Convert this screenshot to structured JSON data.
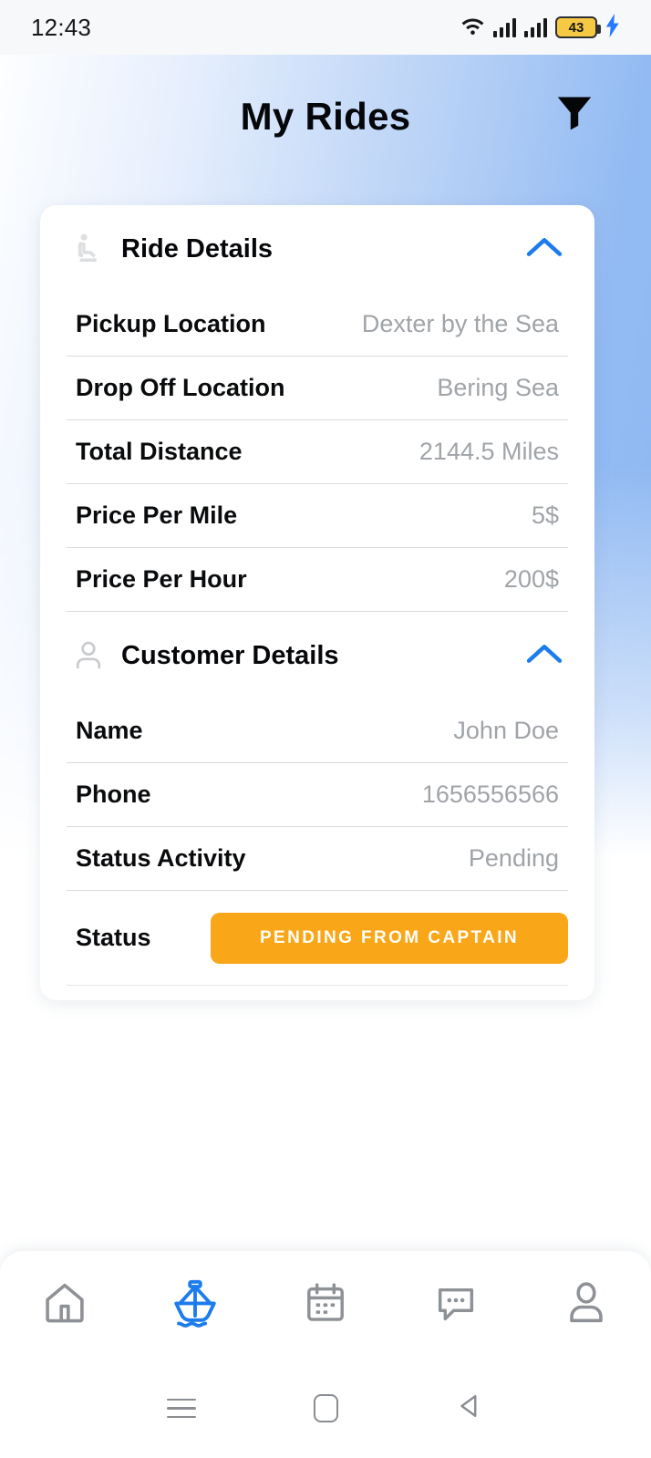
{
  "status_bar": {
    "time": "12:43",
    "wifi_icon": "wifi-icon",
    "signal_icon_1": "cellular-signal-icon",
    "signal_icon_2": "cellular-signal-icon",
    "battery_level": "43",
    "charging_icon": "charging-bolt-icon"
  },
  "header": {
    "title": "My Rides",
    "filter_icon": "filter-funnel-icon"
  },
  "card": {
    "ride_section": {
      "title": "Ride Details",
      "icon": "passenger-seat-icon",
      "collapse_icon": "chevron-up-icon",
      "rows": [
        {
          "label": "Pickup Location",
          "value": "Dexter by the Sea"
        },
        {
          "label": "Drop Off Location",
          "value": "Bering Sea"
        },
        {
          "label": "Total Distance",
          "value": "2144.5 Miles"
        },
        {
          "label": "Price Per Mile",
          "value": "5$"
        },
        {
          "label": "Price Per Hour",
          "value": "200$"
        }
      ]
    },
    "customer_section": {
      "title": "Customer Details",
      "icon": "person-icon",
      "collapse_icon": "chevron-up-icon",
      "rows": [
        {
          "label": "Name",
          "value": "John Doe"
        },
        {
          "label": "Phone",
          "value": "1656556566"
        },
        {
          "label": "Status Activity",
          "value": "Pending"
        }
      ],
      "status_row": {
        "label": "Status",
        "pill_text": "PENDING FROM CAPTAIN",
        "pill_color": "#f9a719"
      }
    }
  },
  "bottom_nav": {
    "active_color": "#1d7ced",
    "inactive_color": "#8e9296",
    "items": [
      {
        "name": "home",
        "icon": "home-icon",
        "active": false
      },
      {
        "name": "rides",
        "icon": "boat-icon",
        "active": true
      },
      {
        "name": "calendar",
        "icon": "calendar-icon",
        "active": false
      },
      {
        "name": "chat",
        "icon": "chat-bubble-icon",
        "active": false
      },
      {
        "name": "profile",
        "icon": "person-icon",
        "active": false
      }
    ]
  },
  "system_nav": {
    "recents_icon": "recents-menu-icon",
    "home_icon": "home-square-icon",
    "back_icon": "back-triangle-icon"
  }
}
